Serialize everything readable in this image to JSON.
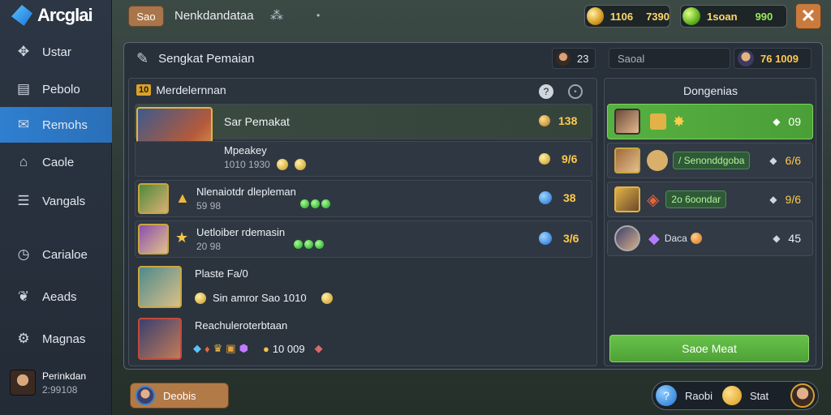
{
  "app": {
    "name": "Arcglai"
  },
  "sidebar": {
    "items": [
      {
        "label": "Ustar",
        "icon": "gamepad-icon"
      },
      {
        "label": "Pebolo",
        "icon": "folder-icon"
      },
      {
        "label": "Remohs",
        "icon": "mail-icon",
        "active": true
      },
      {
        "label": "Caole",
        "icon": "home-icon"
      },
      {
        "label": "Vangals",
        "icon": "list-icon"
      },
      {
        "label": "Carialoe",
        "icon": "clock-icon"
      },
      {
        "label": "Aeads",
        "icon": "leaf-icon"
      },
      {
        "label": "Magnas",
        "icon": "gear-icon"
      }
    ],
    "profile": {
      "name": "Perinkdan",
      "id": "2:99108"
    }
  },
  "topbar": {
    "tab_label": "Sao",
    "title": "Nenkdandataa",
    "resources": [
      {
        "icon": "gold-coin-icon",
        "value1": "1106",
        "value2": "7390"
      },
      {
        "icon": "green-gem-icon",
        "value1": "1soan",
        "value2": "990"
      }
    ],
    "close_icon": "close-icon"
  },
  "panel": {
    "title": "Sengkat Pemaian",
    "player_count": "23",
    "search_placeholder": "Saoal",
    "score": "76 1009"
  },
  "list": {
    "header_badge": "10",
    "header_title": "Merdelernnan",
    "rows": [
      {
        "name": "Sar Pemakat",
        "value": "138",
        "selected": true
      },
      {
        "name": "Mpeakey",
        "sub": "1010 1930",
        "value": "9/6"
      },
      {
        "name": "Nlenaiotdr dlepleman",
        "sub": "59 98",
        "value": "38"
      },
      {
        "name": "Uetloiber rdemasin",
        "sub": "20 98",
        "value": "3/6"
      },
      {
        "name": "Plaste Fa/0",
        "sub": "Sin amror Sao 1010"
      },
      {
        "name": "Reachuleroterbtaan",
        "sub": "10 009"
      }
    ]
  },
  "right": {
    "title": "Dongenias",
    "rows": [
      {
        "value": "09",
        "selected": true
      },
      {
        "pill": "/ Senonddgoba",
        "value": "6/6"
      },
      {
        "pill": "2o 6oondar",
        "value": "9/6"
      },
      {
        "text": "Daca",
        "value": "45"
      }
    ],
    "button_label": "Saoe Meat"
  },
  "bottom": {
    "left_label": "Deobis",
    "right_label1": "Raobi",
    "right_label2": "Stat"
  },
  "colors": {
    "accent": "#2f7fd0",
    "gold": "#ffc94a",
    "green": "#57b041",
    "orange": "#c97b3e"
  }
}
